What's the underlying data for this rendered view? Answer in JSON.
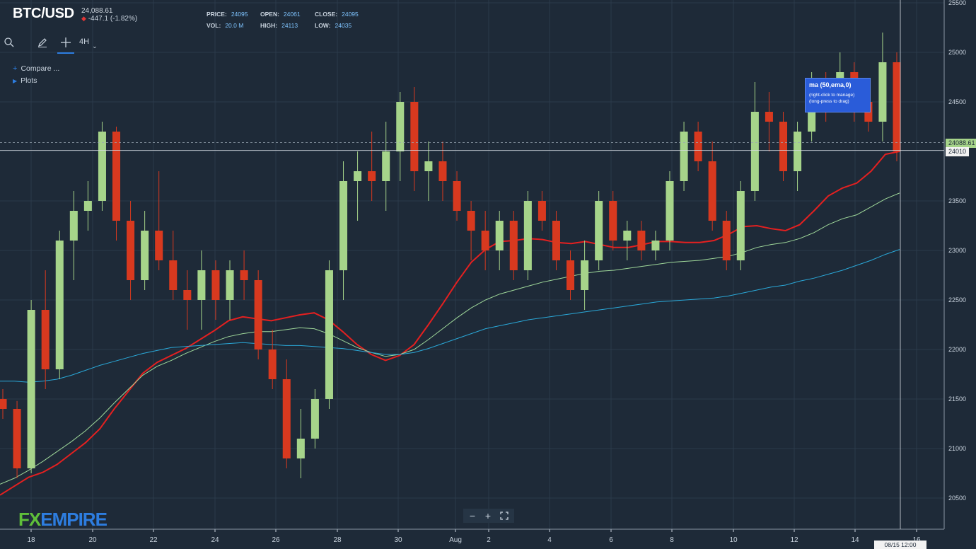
{
  "header": {
    "symbol": "BTC/USD",
    "last_price": "24,088.61",
    "change": "-447.1 (-1.82%)",
    "price_label": "PRICE:",
    "price_value": "24095",
    "open_label": "OPEN:",
    "open_value": "24061",
    "close_label": "CLOSE:",
    "close_value": "24095",
    "vol_label": "VOL:",
    "vol_value": "20.0 M",
    "high_label": "HIGH:",
    "high_value": "24113",
    "low_label": "LOW:",
    "low_value": "24035"
  },
  "toolbar": {
    "search_icon": "search-icon",
    "draw_icon": "pencil-icon",
    "crosshair_icon": "crosshair-icon",
    "interval": "4H"
  },
  "menu": {
    "compare": "Compare ...",
    "plots": "Plots"
  },
  "tooltip": {
    "title": "ma (50,ema,0)",
    "line1": "(right-click to manage)",
    "line2": "(long-press to drag)"
  },
  "zoom": {
    "minus": "−",
    "plus": "+",
    "fullscreen_icon": "fullscreen-icon"
  },
  "logo": {
    "fx": "FX",
    "empire": "EMPIRE"
  },
  "crosshair": {
    "price_tag": "24010",
    "date_tag": "08/15 12:00"
  },
  "last_price_tag": "24088.61",
  "colors": {
    "background": "#1e2a38",
    "up": "#a6d48a",
    "down": "#d8391f",
    "ema50": "#e42020",
    "ma_slow": "#9fd89a",
    "ma_long": "#2aa8d8",
    "accent": "#2d7de0"
  },
  "chart_data": {
    "type": "candlestick",
    "timeframe": "4H",
    "y_ticks": [
      20500,
      21000,
      21500,
      22000,
      22500,
      23000,
      23500,
      24000,
      24500,
      25000,
      25500
    ],
    "x_ticks": [
      "18",
      "20",
      "22",
      "24",
      "26",
      "28",
      "30",
      "Aug",
      "2",
      "4",
      "6",
      "8",
      "10",
      "12",
      "14",
      "16"
    ],
    "ylim": [
      20200,
      25500
    ],
    "last_price": 24088.61,
    "series": [
      {
        "name": "ma (50,ema,0)",
        "values": [
          20530,
          20620,
          20710,
          20760,
          20840,
          20950,
          21060,
          21200,
          21400,
          21580,
          21760,
          21870,
          21940,
          22010,
          22100,
          22190,
          22290,
          22330,
          22310,
          22290,
          22320,
          22350,
          22370,
          22300,
          22180,
          22050,
          21950,
          21890,
          21940,
          22050,
          22250,
          22460,
          22680,
          22880,
          23010,
          23090,
          23100,
          23120,
          23110,
          23080,
          23070,
          23090,
          23060,
          23030,
          23030,
          23060,
          23090,
          23090,
          23080,
          23080,
          23100,
          23160,
          23240,
          23250,
          23220,
          23200,
          23260,
          23400,
          23550,
          23630,
          23680,
          23800,
          23970,
          24000
        ]
      },
      {
        "name": "ma slow",
        "values": [
          20640,
          20700,
          20780,
          20870,
          20970,
          21070,
          21180,
          21310,
          21460,
          21600,
          21740,
          21830,
          21890,
          21960,
          22020,
          22080,
          22130,
          22160,
          22180,
          22180,
          22200,
          22220,
          22210,
          22160,
          22090,
          22020,
          21970,
          21930,
          21950,
          22000,
          22100,
          22210,
          22320,
          22420,
          22500,
          22560,
          22600,
          22640,
          22680,
          22710,
          22740,
          22770,
          22790,
          22800,
          22820,
          22840,
          22860,
          22880,
          22890,
          22900,
          22920,
          22940,
          22980,
          23030,
          23060,
          23080,
          23120,
          23180,
          23260,
          23320,
          23360,
          23440,
          23520,
          23580
        ]
      },
      {
        "name": "ma long",
        "values": [
          21680,
          21680,
          21670,
          21680,
          21700,
          21740,
          21790,
          21840,
          21880,
          21920,
          21960,
          21990,
          22020,
          22030,
          22040,
          22050,
          22060,
          22070,
          22060,
          22050,
          22040,
          22040,
          22030,
          22020,
          22010,
          21990,
          21970,
          21950,
          21950,
          21970,
          22010,
          22060,
          22110,
          22160,
          22210,
          22240,
          22270,
          22300,
          22320,
          22340,
          22360,
          22380,
          22400,
          22420,
          22440,
          22460,
          22480,
          22490,
          22500,
          22510,
          22520,
          22540,
          22570,
          22600,
          22630,
          22650,
          22690,
          22720,
          22760,
          22800,
          22850,
          22900,
          22960,
          23010
        ]
      }
    ],
    "candles": [
      [
        21500,
        21600,
        21300,
        21400
      ],
      [
        21400,
        21480,
        20700,
        20800
      ],
      [
        20800,
        22500,
        20750,
        22400
      ],
      [
        22400,
        22800,
        21600,
        21800
      ],
      [
        21800,
        23200,
        21700,
        23100
      ],
      [
        23100,
        23600,
        22700,
        23400
      ],
      [
        23400,
        23700,
        23200,
        23500
      ],
      [
        23500,
        24300,
        23400,
        24200
      ],
      [
        24200,
        24250,
        23100,
        23300
      ],
      [
        23300,
        23500,
        22500,
        22700
      ],
      [
        22700,
        23400,
        22600,
        23200
      ],
      [
        23200,
        23800,
        22800,
        22900
      ],
      [
        22900,
        23200,
        22500,
        22600
      ],
      [
        22600,
        22800,
        22200,
        22500
      ],
      [
        22500,
        23000,
        22200,
        22800
      ],
      [
        22800,
        22900,
        22300,
        22500
      ],
      [
        22500,
        22900,
        22300,
        22800
      ],
      [
        22800,
        23000,
        22500,
        22700
      ],
      [
        22700,
        22800,
        21900,
        22000
      ],
      [
        22000,
        22200,
        21600,
        21700
      ],
      [
        21700,
        21900,
        20800,
        20900
      ],
      [
        20900,
        21400,
        20700,
        21100
      ],
      [
        21100,
        21600,
        21000,
        21500
      ],
      [
        21500,
        22900,
        21400,
        22800
      ],
      [
        22800,
        23900,
        22500,
        23700
      ],
      [
        23700,
        24000,
        23300,
        23800
      ],
      [
        23800,
        24200,
        23500,
        23700
      ],
      [
        23700,
        24300,
        23400,
        24000
      ],
      [
        24000,
        24600,
        23700,
        24500
      ],
      [
        24500,
        24650,
        23600,
        23800
      ],
      [
        23800,
        24100,
        23500,
        23900
      ],
      [
        23900,
        24100,
        23500,
        23700
      ],
      [
        23700,
        23800,
        23300,
        23400
      ],
      [
        23400,
        23500,
        22900,
        23200
      ],
      [
        23200,
        23400,
        22800,
        23000
      ],
      [
        23000,
        23400,
        22800,
        23300
      ],
      [
        23300,
        23400,
        22700,
        22800
      ],
      [
        22800,
        23600,
        22700,
        23500
      ],
      [
        23500,
        23600,
        23200,
        23300
      ],
      [
        23300,
        23400,
        22800,
        22900
      ],
      [
        22900,
        23000,
        22500,
        22600
      ],
      [
        22600,
        23100,
        22400,
        22900
      ],
      [
        22900,
        23600,
        22800,
        23500
      ],
      [
        23500,
        23600,
        23000,
        23100
      ],
      [
        23100,
        23300,
        22900,
        23200
      ],
      [
        23200,
        23300,
        22900,
        23000
      ],
      [
        23000,
        23200,
        22900,
        23100
      ],
      [
        23100,
        23800,
        23000,
        23700
      ],
      [
        23700,
        24300,
        23600,
        24200
      ],
      [
        24200,
        24300,
        23800,
        23900
      ],
      [
        23900,
        24100,
        23200,
        23300
      ],
      [
        23300,
        23400,
        22800,
        22900
      ],
      [
        22900,
        23700,
        22800,
        23600
      ],
      [
        23600,
        24700,
        23500,
        24400
      ],
      [
        24400,
        24600,
        24000,
        24300
      ],
      [
        24300,
        24400,
        23700,
        23800
      ],
      [
        23800,
        24300,
        23600,
        24200
      ],
      [
        24200,
        24800,
        24100,
        24700
      ],
      [
        24700,
        24800,
        24300,
        24600
      ],
      [
        24600,
        25000,
        24400,
        24800
      ],
      [
        24800,
        24900,
        24300,
        24500
      ],
      [
        24500,
        24600,
        24200,
        24300
      ],
      [
        24300,
        25200,
        24100,
        24900
      ],
      [
        24900,
        25000,
        23900,
        24000
      ]
    ]
  }
}
